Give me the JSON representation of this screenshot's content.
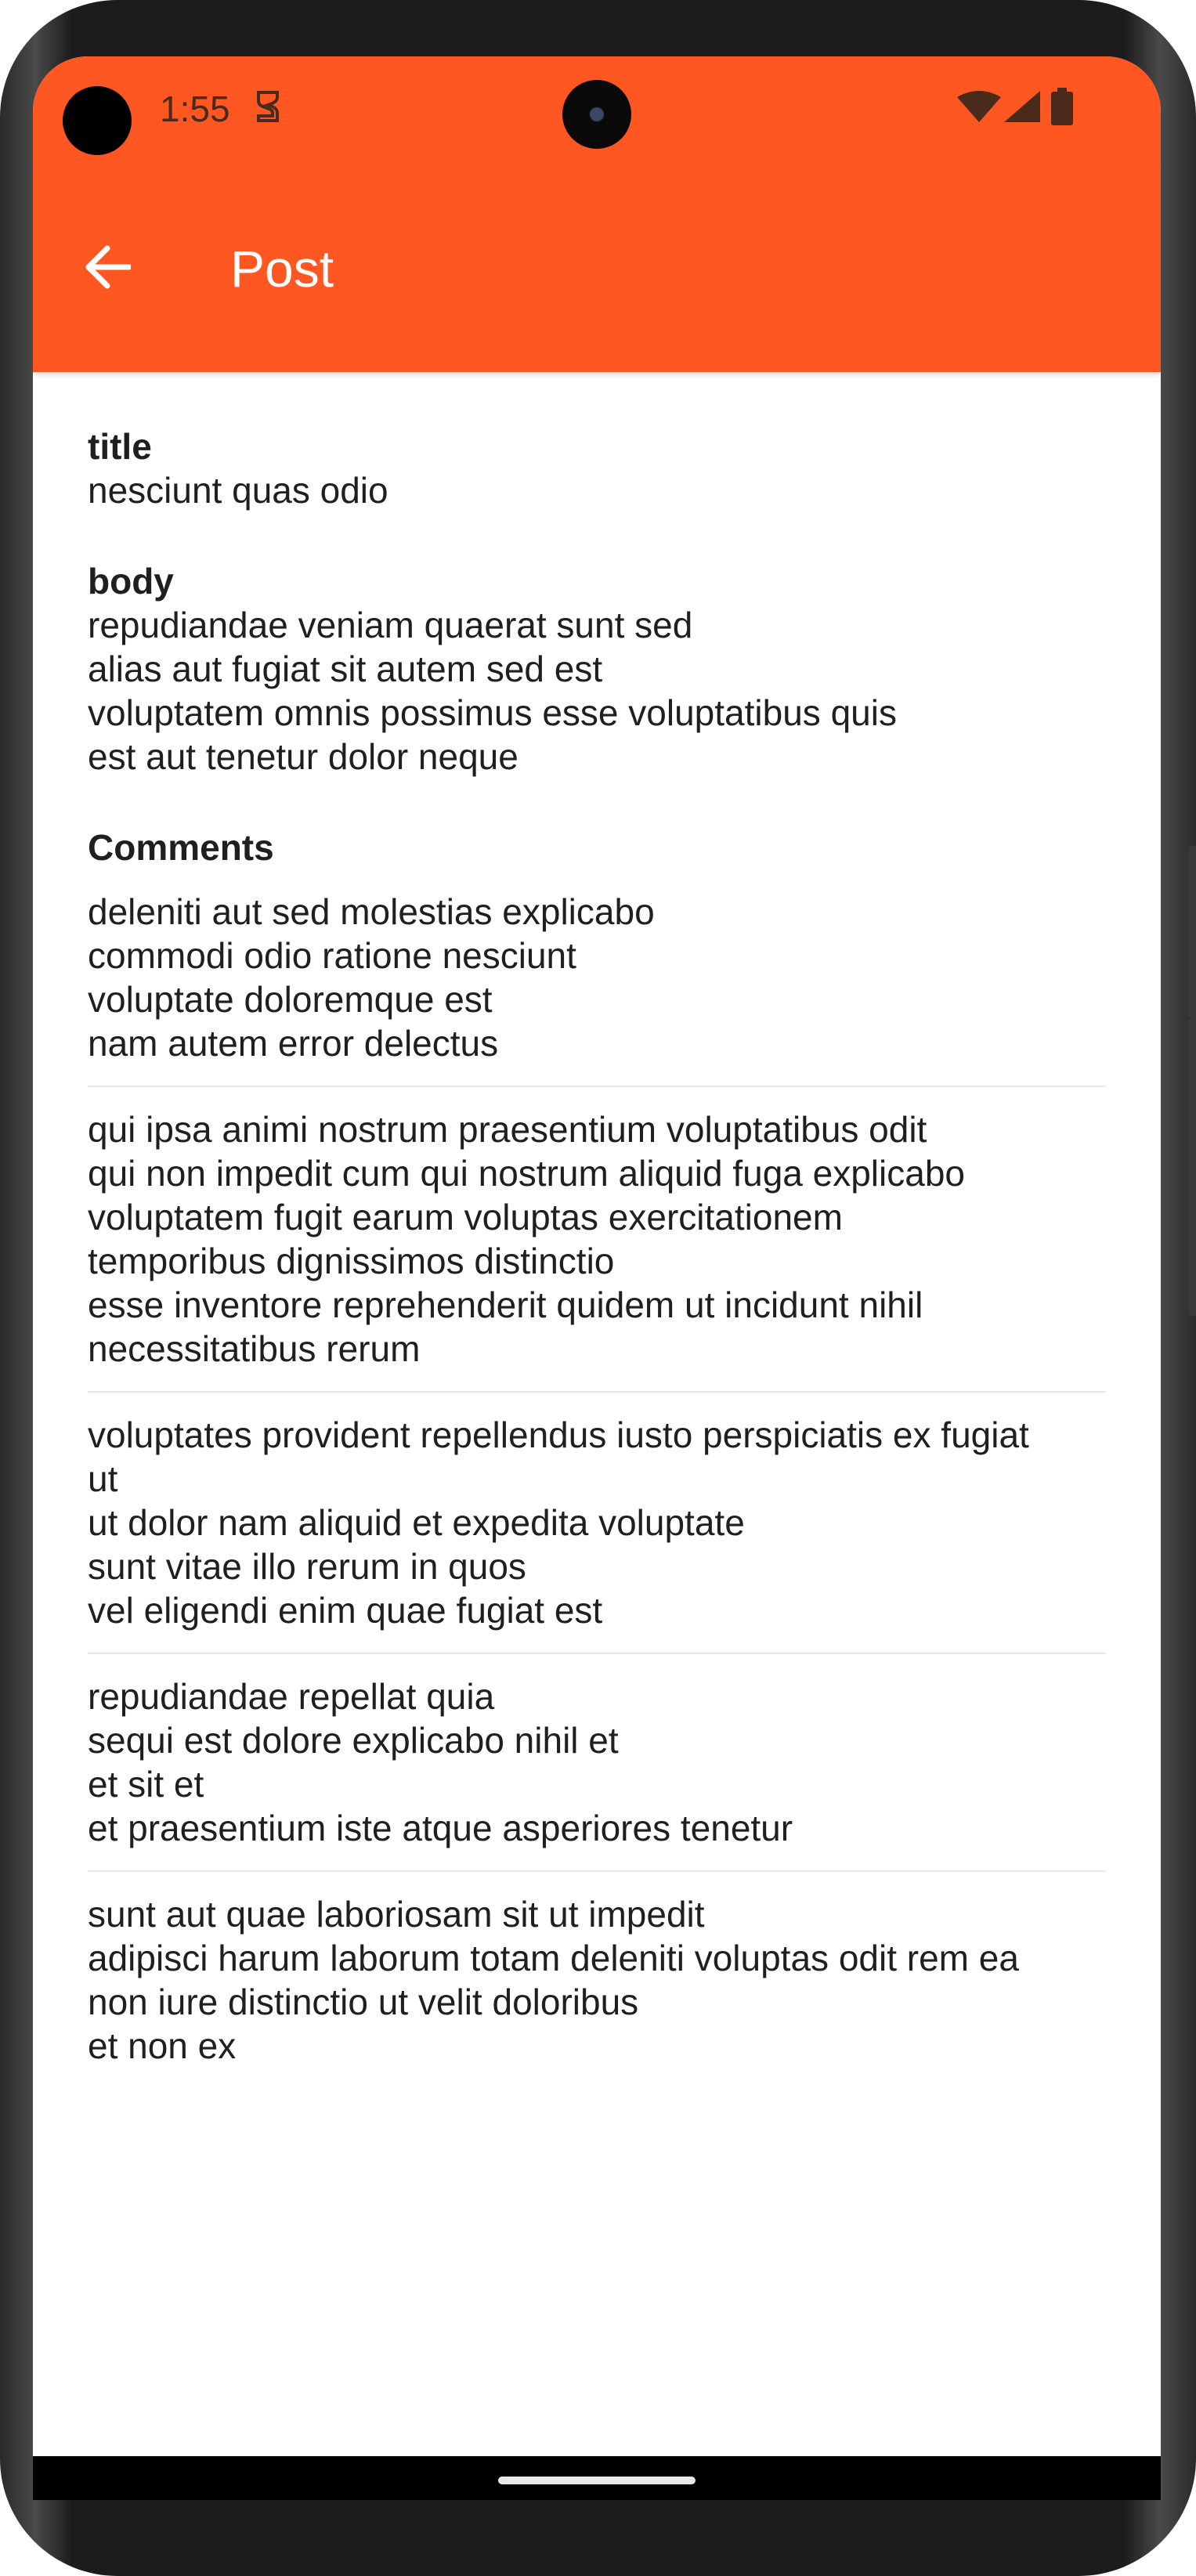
{
  "status_bar": {
    "time": "1:55",
    "icons": [
      "notification-icon",
      "wifi-icon",
      "signal-icon",
      "battery-icon"
    ]
  },
  "app_bar": {
    "title": "Post",
    "back_icon": "arrow-back-icon",
    "color": "#ff5722"
  },
  "post": {
    "title_label": "title",
    "title_value": "nesciunt quas odio",
    "body_label": "body",
    "body_lines": [
      "repudiandae veniam quaerat sunt sed",
      "alias aut fugiat sit autem sed est",
      "voluptatem omnis possimus esse voluptatibus quis",
      "est aut tenetur dolor neque"
    ]
  },
  "comments": {
    "heading": "Comments",
    "items": [
      {
        "lines": [
          "deleniti aut sed molestias explicabo",
          "commodi odio ratione nesciunt",
          "voluptate doloremque est",
          "nam autem error delectus"
        ]
      },
      {
        "lines": [
          "qui ipsa animi nostrum praesentium voluptatibus odit",
          "qui non impedit cum qui nostrum aliquid fuga explicabo",
          "voluptatem fugit earum voluptas exercitationem",
          "temporibus dignissimos distinctio",
          "esse inventore reprehenderit quidem ut incidunt nihil",
          "necessitatibus rerum"
        ]
      },
      {
        "lines": [
          "voluptates provident repellendus iusto perspiciatis ex fugiat",
          "ut",
          "ut dolor nam aliquid et expedita voluptate",
          "sunt vitae illo rerum in quos",
          "vel eligendi enim quae fugiat est"
        ]
      },
      {
        "lines": [
          "repudiandae repellat quia",
          "sequi est dolore explicabo nihil et",
          "et sit et",
          "et praesentium iste atque asperiores tenetur"
        ]
      },
      {
        "lines": [
          "sunt aut quae laboriosam sit ut impedit",
          "adipisci harum laborum totam deleniti voluptas odit rem ea",
          "non iure distinctio ut velit doloribus",
          "et non ex"
        ]
      }
    ]
  }
}
